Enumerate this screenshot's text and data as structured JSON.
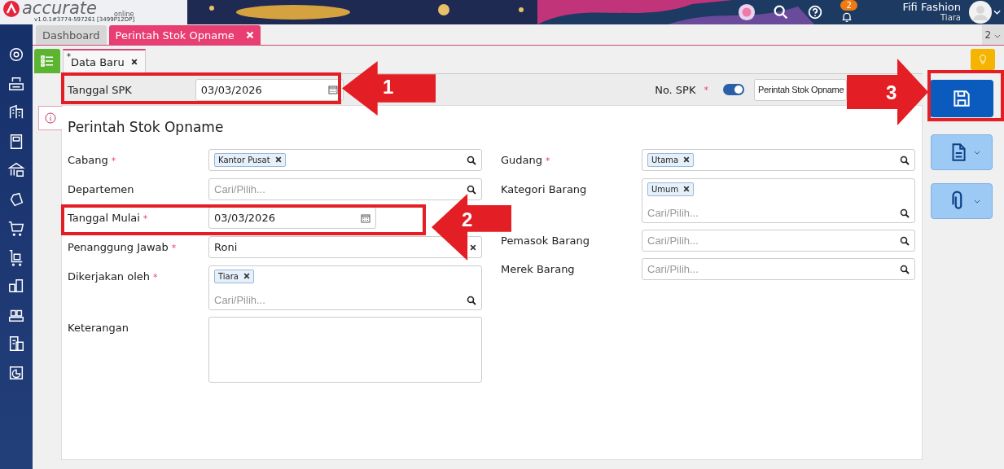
{
  "header": {
    "logo": "accurate",
    "logo_sub": "online",
    "version": "v1.0.1#3774-597261 [3499P12DP]",
    "notifications": "2",
    "company": "Fifi Fashion",
    "user": "Tiara"
  },
  "tabs": [
    {
      "label": "Dashboard",
      "selected": false,
      "closable": false
    },
    {
      "label": "Perintah Stok Opname",
      "selected": true,
      "closable": true
    }
  ],
  "tab_overflow": "2",
  "doc_tab": {
    "mark": "*",
    "label": "Data Baru"
  },
  "top_fields": {
    "date_label": "Tanggal SPK",
    "date_value": "03/03/2026",
    "number_label": "No. SPK",
    "required": "*",
    "auto_number": true,
    "number_value": "Perintah Stok Opname"
  },
  "form": {
    "title": "Perintah Stok Opname",
    "left": [
      {
        "label": "Cabang",
        "required": true,
        "kind": "tags",
        "tags": [
          "Kantor Pusat"
        ]
      },
      {
        "label": "Departemen",
        "required": false,
        "kind": "search",
        "placeholder": "Cari/Pilih..."
      },
      {
        "label": "Tanggal Mulai",
        "required": true,
        "kind": "date",
        "value": "03/03/2026"
      },
      {
        "label": "Penanggung Jawab",
        "required": true,
        "kind": "clearable",
        "value": "Roni"
      },
      {
        "label": "Dikerjakan oleh",
        "required": true,
        "kind": "multi",
        "tags": [
          "Tiara"
        ],
        "placeholder": "Cari/Pilih..."
      },
      {
        "label": "Keterangan",
        "required": false,
        "kind": "textarea"
      }
    ],
    "right": [
      {
        "label": "Gudang",
        "required": true,
        "kind": "tags",
        "tags": [
          "Utama"
        ]
      },
      {
        "label": "Kategori Barang",
        "required": false,
        "kind": "multi",
        "tags": [
          "Umum"
        ],
        "placeholder": "Cari/Pilih..."
      },
      {
        "label": "Pemasok Barang",
        "required": false,
        "kind": "search",
        "placeholder": "Cari/Pilih..."
      },
      {
        "label": "Merek Barang",
        "required": false,
        "kind": "search",
        "placeholder": "Cari/Pilih..."
      }
    ]
  },
  "annotations": [
    {
      "label": "1"
    },
    {
      "label": "2"
    },
    {
      "label": "3"
    }
  ]
}
